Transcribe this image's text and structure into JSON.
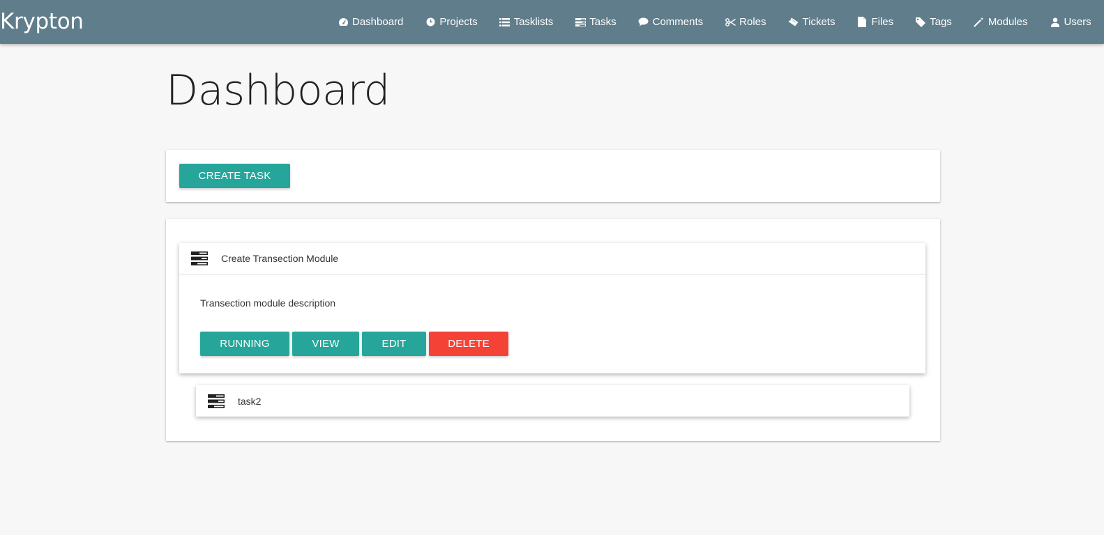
{
  "navbar": {
    "brand": "Krypton",
    "items": [
      {
        "label": "Dashboard",
        "icon": "dashboard-icon"
      },
      {
        "label": "Projects",
        "icon": "projects-icon"
      },
      {
        "label": "Tasklists",
        "icon": "list-icon"
      },
      {
        "label": "Tasks",
        "icon": "tasks-icon"
      },
      {
        "label": "Comments",
        "icon": "comment-icon"
      },
      {
        "label": "Roles",
        "icon": "scissors-icon"
      },
      {
        "label": "Tickets",
        "icon": "ticket-icon"
      },
      {
        "label": "Files",
        "icon": "file-icon"
      },
      {
        "label": "Tags",
        "icon": "tag-icon"
      },
      {
        "label": "Modules",
        "icon": "magic-wand-icon"
      },
      {
        "label": "Users",
        "icon": "user-icon"
      }
    ]
  },
  "page": {
    "title": "Dashboard"
  },
  "toolbar": {
    "create_label": "CREATE TASK"
  },
  "tasks": [
    {
      "title": "Create Transection Module",
      "description": "Transection module description",
      "buttons": {
        "running": "RUNNING",
        "view": "VIEW",
        "edit": "EDIT",
        "delete": "DELETE"
      }
    },
    {
      "title": "task2"
    }
  ],
  "colors": {
    "navbar": "#607d8b",
    "accent": "#26a69a",
    "danger": "#f44336",
    "background": "#f7f7f7"
  }
}
